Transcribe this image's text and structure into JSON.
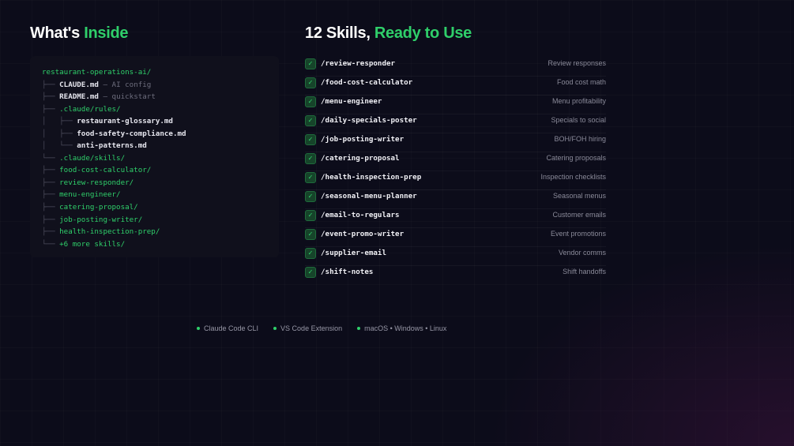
{
  "left_heading": {
    "text": "What's ",
    "accent": "Inside"
  },
  "right_heading": {
    "text": "12 Skills, ",
    "accent": "Ready to Use"
  },
  "tree": [
    {
      "prefix": "",
      "name": "restaurant-operations-ai/",
      "dir": true,
      "comment": ""
    },
    {
      "prefix": "├── ",
      "name": "CLAUDE.md",
      "dir": false,
      "comment": " — AI config"
    },
    {
      "prefix": "├── ",
      "name": "README.md",
      "dir": false,
      "comment": " — quickstart"
    },
    {
      "prefix": "├── ",
      "name": ".claude/rules/",
      "dir": true,
      "comment": ""
    },
    {
      "prefix": "│   ├── ",
      "name": "restaurant-glossary.md",
      "dir": false,
      "comment": ""
    },
    {
      "prefix": "│   ├── ",
      "name": "food-safety-compliance.md",
      "dir": false,
      "comment": ""
    },
    {
      "prefix": "│   └── ",
      "name": "anti-patterns.md",
      "dir": false,
      "comment": ""
    },
    {
      "prefix": "└── ",
      "name": ".claude/skills/",
      "dir": true,
      "comment": ""
    },
    {
      "prefix": "├── ",
      "name": "food-cost-calculator/",
      "dir": true,
      "comment": ""
    },
    {
      "prefix": "├── ",
      "name": "review-responder/",
      "dir": true,
      "comment": ""
    },
    {
      "prefix": "├── ",
      "name": "menu-engineer/",
      "dir": true,
      "comment": ""
    },
    {
      "prefix": "├── ",
      "name": "catering-proposal/",
      "dir": true,
      "comment": ""
    },
    {
      "prefix": "├── ",
      "name": "job-posting-writer/",
      "dir": true,
      "comment": ""
    },
    {
      "prefix": "├── ",
      "name": "health-inspection-prep/",
      "dir": true,
      "comment": ""
    },
    {
      "prefix": "└── ",
      "name": "+6 more skills/",
      "dir": true,
      "comment": ""
    }
  ],
  "skills": [
    {
      "check": "✓",
      "command": "/review-responder",
      "description": "Review responses"
    },
    {
      "check": "✓",
      "command": "/food-cost-calculator",
      "description": "Food cost math"
    },
    {
      "check": "✓",
      "command": "/menu-engineer",
      "description": "Menu profitability"
    },
    {
      "check": "✓",
      "command": "/daily-specials-poster",
      "description": "Specials to social"
    },
    {
      "check": "✓",
      "command": "/job-posting-writer",
      "description": "BOH/FOH hiring"
    },
    {
      "check": "✓",
      "command": "/catering-proposal",
      "description": "Catering proposals"
    },
    {
      "check": "✓",
      "command": "/health-inspection-prep",
      "description": "Inspection checklists"
    },
    {
      "check": "✓",
      "command": "/seasonal-menu-planner",
      "description": "Seasonal menus"
    },
    {
      "check": "✓",
      "command": "/email-to-regulars",
      "description": "Customer emails"
    },
    {
      "check": "✓",
      "command": "/event-promo-writer",
      "description": "Event promotions"
    },
    {
      "check": "✓",
      "command": "/supplier-email",
      "description": "Vendor comms"
    },
    {
      "check": "✓",
      "command": "/shift-notes",
      "description": "Shift handoffs"
    }
  ],
  "badges": [
    "Claude Code CLI",
    "VS Code Extension",
    "macOS • Windows • Linux"
  ],
  "colors": {
    "accent": "#2fcf6a",
    "background": "#0c0c1a"
  },
  "icons": {
    "check": "check-icon",
    "dot": "dot-icon"
  }
}
